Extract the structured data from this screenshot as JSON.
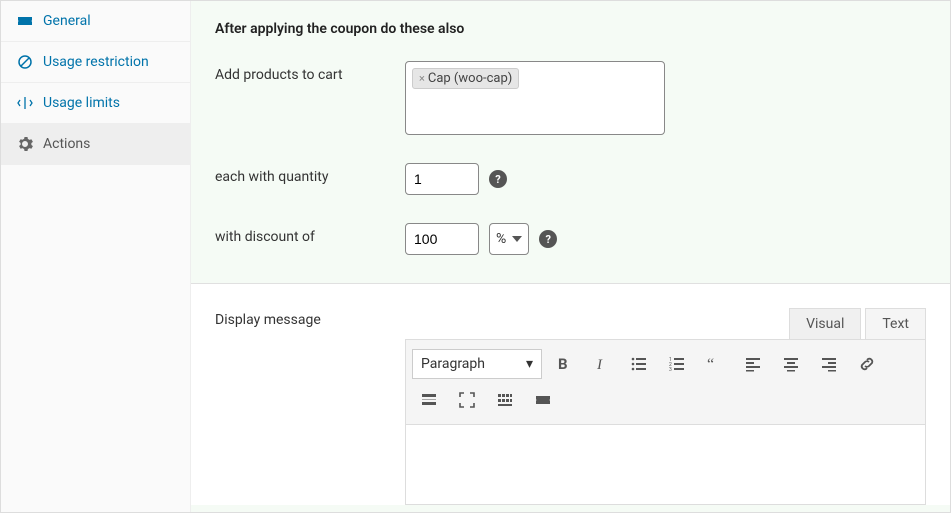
{
  "sidebar": {
    "items": [
      {
        "label": "General"
      },
      {
        "label": "Usage restriction"
      },
      {
        "label": "Usage limits"
      },
      {
        "label": "Actions"
      }
    ]
  },
  "section": {
    "heading": "After applying the coupon do these also"
  },
  "form": {
    "add_products_label": "Add products to cart",
    "product_chip": "Cap (woo-cap)",
    "chip_remove": "×",
    "quantity_label": "each with quantity",
    "quantity_value": "1",
    "discount_label": "with discount of",
    "discount_value": "100",
    "discount_unit": "%",
    "help_text": "?"
  },
  "editor": {
    "display_label": "Display message",
    "tabs": {
      "visual": "Visual",
      "text": "Text"
    },
    "format": "Paragraph"
  }
}
